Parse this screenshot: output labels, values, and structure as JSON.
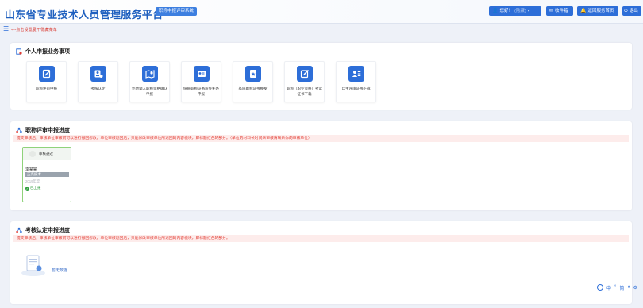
{
  "header": {
    "title": "山东省专业技术人员管理服务平台",
    "system_badge": "职称申报评审系统",
    "user_label": "您好！",
    "user_name": "(隐藏)",
    "inbox_label": "收件箱",
    "back_label": "返回服务首页",
    "exit_label": "退出"
  },
  "breadcrumb": {
    "text": "<--点击设置展开/隐藏菜单"
  },
  "services": {
    "title": "个人申报业务事项",
    "items": [
      {
        "label": "职称评审申报",
        "icon": "edit-icon"
      },
      {
        "label": "考核认定",
        "icon": "user-doc-icon"
      },
      {
        "label": "外地调入职称资格确认申报",
        "icon": "map-icon"
      },
      {
        "label": "纸质职称证书遗失补办申报",
        "icon": "id-card-icon"
      },
      {
        "label": "基层职称证书换发",
        "icon": "certificate-icon"
      },
      {
        "label": "职称（职业资格）考试证书下载",
        "icon": "write-icon"
      },
      {
        "label": "自主评审证书下载",
        "icon": "user-list-icon"
      }
    ]
  },
  "title_progress": {
    "title": "职称评审申报进度",
    "notice": "提交审核后，审核单位审核前可以进行撤回修改。单位审核退回后，只能修改审核单位所退回的内容模块，即标题红色的部分。（单位的材料长时间未审核请联系你的审核单位）",
    "card": {
      "state": "审核通过",
      "name": "李某某",
      "level": "正高技术",
      "sub": "2019年度",
      "status": "已上报"
    }
  },
  "assessment_progress": {
    "title": "考核认定申报进度",
    "notice": "提交审核后，审核单位审核前可以进行撤回修改。单位审核退回后，只能修改审核单位所退回的内容模块，即标题红色的部分。",
    "empty_text": "暂无数据......"
  },
  "toolbar": {
    "items": [
      "中",
      "°",
      "简",
      "♦",
      "⚙"
    ]
  },
  "colors": {
    "brand": "#2d6ed8",
    "notice_text": "#e23a31",
    "notice_bg": "#fdeceb",
    "success": "#2c9c3a"
  }
}
